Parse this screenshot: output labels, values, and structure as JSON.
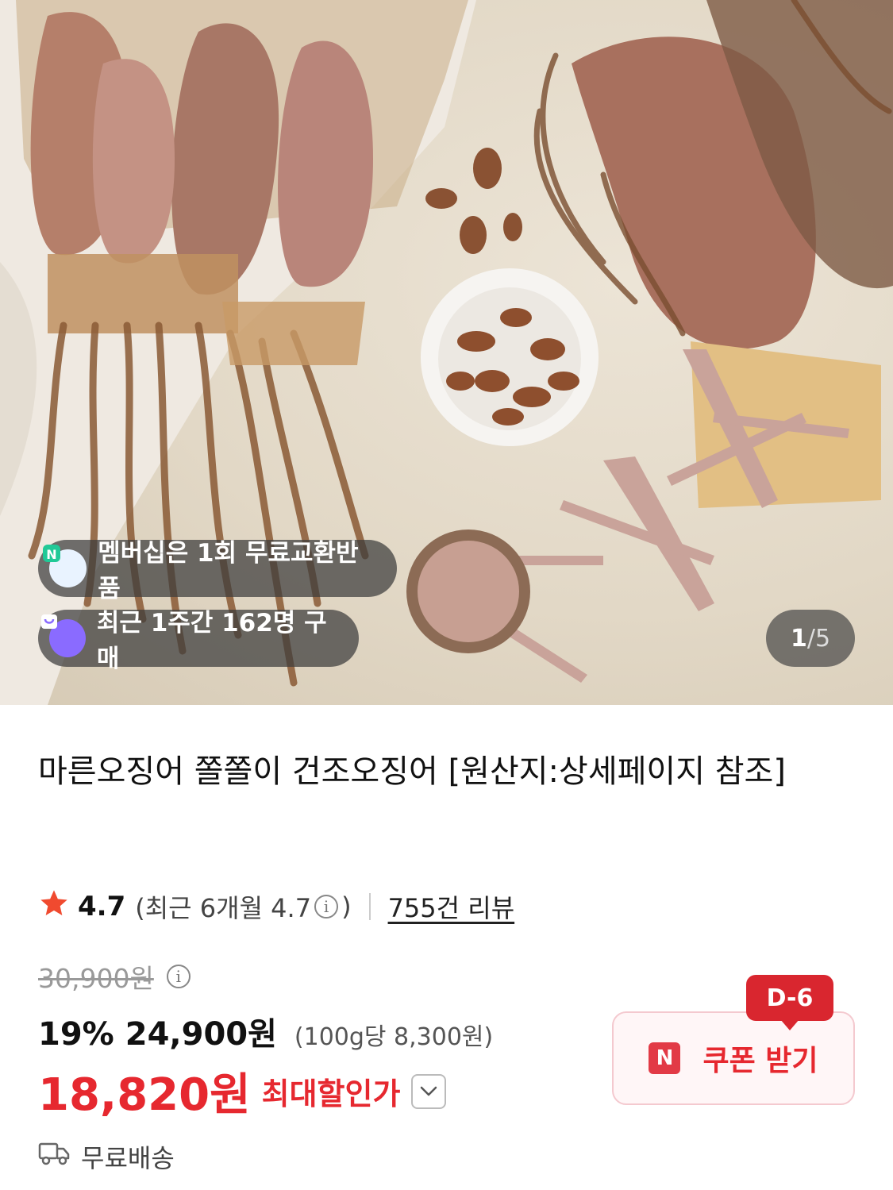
{
  "image": {
    "alt": "",
    "badges": {
      "membership": "멤버십은 1회 무료교환반품",
      "recent_purchase": "최근 1주간 162명 구매"
    },
    "counter": {
      "current": "1",
      "separator": "/",
      "total": "5"
    }
  },
  "product": {
    "title": "마른오징어 쫄쫄이 건조오징어 [원산지:상세페이지 참조]"
  },
  "rating": {
    "score": "4.7",
    "recent_prefix": "(최근 6개월 4.7",
    "recent_suffix": ")",
    "reviews": "755건 리뷰"
  },
  "price": {
    "original": "30,900원",
    "discount_pct": "19%",
    "sale": "24,900원",
    "unit_price": "(100g당 8,300원)",
    "max_discount_price": "18,820원",
    "max_discount_label": "최대할인가"
  },
  "coupon": {
    "dday": "D-6",
    "badge": "N",
    "label": "쿠폰 받기"
  },
  "shipping": {
    "label": "무료배송"
  },
  "colors": {
    "accent": "#e6282f",
    "coupon_bg": "#fff6f7",
    "star": "#f04a2f"
  }
}
